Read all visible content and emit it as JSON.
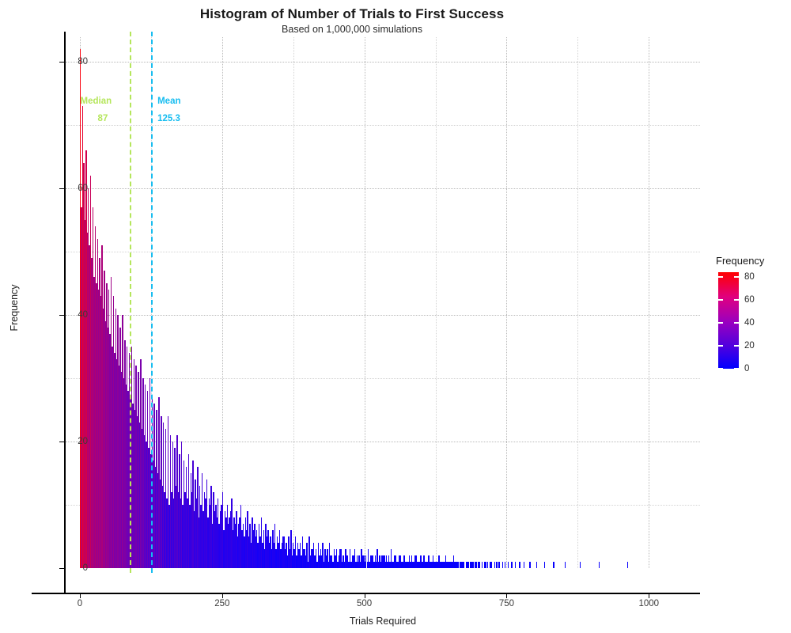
{
  "chart_data": {
    "type": "bar",
    "title": "Histogram of Number of Trials to First Success",
    "subtitle": "Based on 1,000,000 simulations",
    "xlabel": "Trials Required",
    "ylabel": "Frequency",
    "xlim": [
      -25,
      1090
    ],
    "ylim": [
      0,
      84
    ],
    "grid": true,
    "x_ticks": [
      "0",
      "250",
      "500",
      "750",
      "1000"
    ],
    "x_tick_values": [
      0,
      250,
      500,
      750,
      1000
    ],
    "y_ticks": [
      "0",
      "20",
      "40",
      "60",
      "80"
    ],
    "y_tick_values": [
      0,
      20,
      40,
      60,
      80
    ],
    "y_minor_values": [
      10,
      30,
      50,
      70
    ],
    "x_minor_values": [
      125,
      375,
      625,
      875
    ],
    "legend": {
      "title": "Frequency",
      "position": "right",
      "type": "colorbar",
      "ticks": [
        "0",
        "20",
        "40",
        "60",
        "80"
      ],
      "tick_values": [
        0,
        20,
        40,
        60,
        80
      ],
      "low_color": "#0000ff",
      "high_color": "#ff0000",
      "range": [
        0,
        84
      ]
    },
    "annotations": [
      {
        "name": "median",
        "label": "Median",
        "value": "87",
        "x": 87,
        "color": "#b5e65c",
        "linetype": "dashed"
      },
      {
        "name": "mean",
        "label": "Mean",
        "value": "125.3",
        "x": 125.3,
        "color": "#17bdf0",
        "linetype": "dashed"
      }
    ],
    "bin_width": 2,
    "x": [
      1,
      3,
      5,
      7,
      9,
      11,
      13,
      15,
      17,
      19,
      21,
      23,
      25,
      27,
      29,
      31,
      33,
      35,
      37,
      39,
      41,
      43,
      45,
      47,
      49,
      51,
      53,
      55,
      57,
      59,
      61,
      63,
      65,
      67,
      69,
      71,
      73,
      75,
      77,
      79,
      81,
      83,
      85,
      87,
      89,
      91,
      93,
      95,
      97,
      99,
      101,
      103,
      105,
      107,
      109,
      111,
      113,
      115,
      117,
      119,
      121,
      123,
      125,
      127,
      129,
      131,
      133,
      135,
      137,
      139,
      141,
      143,
      145,
      147,
      149,
      151,
      153,
      155,
      157,
      159,
      161,
      163,
      165,
      167,
      169,
      171,
      173,
      175,
      177,
      179,
      181,
      183,
      185,
      187,
      189,
      191,
      193,
      195,
      197,
      199,
      201,
      203,
      205,
      207,
      209,
      211,
      213,
      215,
      217,
      219,
      221,
      223,
      225,
      227,
      229,
      231,
      233,
      235,
      237,
      239,
      241,
      243,
      245,
      247,
      249,
      251,
      253,
      255,
      257,
      259,
      261,
      263,
      265,
      267,
      269,
      271,
      273,
      275,
      277,
      279,
      281,
      283,
      285,
      287,
      289,
      291,
      293,
      295,
      297,
      299,
      301,
      303,
      305,
      307,
      309,
      311,
      313,
      315,
      317,
      319,
      321,
      323,
      325,
      327,
      329,
      331,
      333,
      335,
      337,
      339,
      341,
      343,
      345,
      347,
      349,
      351,
      353,
      355,
      357,
      359,
      361,
      363,
      365,
      367,
      369,
      371,
      373,
      375,
      377,
      379,
      381,
      383,
      385,
      387,
      389,
      391,
      393,
      395,
      397,
      399,
      401,
      403,
      405,
      407,
      409,
      411,
      413,
      415,
      417,
      419,
      421,
      423,
      425,
      427,
      429,
      431,
      433,
      435,
      437,
      439,
      441,
      443,
      445,
      447,
      449,
      451,
      453,
      455,
      457,
      459,
      461,
      463,
      465,
      467,
      469,
      471,
      473,
      475,
      477,
      479,
      481,
      483,
      485,
      487,
      489,
      491,
      493,
      495,
      497,
      499,
      501,
      503,
      505,
      507,
      509,
      511,
      513,
      515,
      517,
      519,
      521,
      523,
      525,
      527,
      529,
      531,
      533,
      535,
      537,
      539,
      541,
      543,
      545,
      547,
      549,
      551,
      553,
      555,
      557,
      559,
      561,
      563,
      565,
      567,
      569,
      571,
      573,
      575,
      577,
      579,
      581,
      583,
      585,
      587,
      589,
      591,
      593,
      595,
      597,
      599,
      601,
      603,
      605,
      607,
      609,
      611,
      613,
      615,
      617,
      619,
      621,
      623,
      625,
      627,
      629,
      631,
      633,
      635,
      637,
      639,
      641,
      643,
      645,
      647,
      649,
      651,
      653,
      655,
      657,
      659,
      661,
      663,
      665,
      667,
      669,
      671,
      673,
      675,
      677,
      679,
      681,
      683,
      685,
      687,
      689,
      691,
      693,
      695,
      697,
      699,
      701,
      703,
      705,
      707,
      709,
      711,
      713,
      715,
      717,
      719,
      721,
      723,
      725,
      727,
      729,
      731,
      733,
      735,
      737,
      739,
      741,
      743,
      745,
      747,
      749,
      751,
      753,
      755,
      757,
      759,
      761,
      763,
      765,
      767,
      769,
      771,
      773,
      775,
      777,
      779,
      781,
      783,
      785,
      787,
      789,
      791,
      793,
      795,
      797,
      799,
      801,
      803,
      805,
      807,
      809,
      811,
      813,
      815,
      817,
      819,
      821,
      823,
      825,
      827,
      829,
      831,
      833,
      835,
      837,
      839,
      841,
      843,
      845,
      847,
      849,
      851,
      853,
      855,
      857,
      859,
      861,
      863,
      865,
      867,
      869,
      871,
      873,
      875,
      877,
      879,
      881,
      883,
      885,
      887,
      889,
      891,
      893,
      895,
      897,
      899,
      901,
      903,
      905,
      907,
      909,
      911,
      913,
      915,
      917,
      919,
      921,
      923,
      925,
      927,
      929,
      931,
      933,
      935,
      937,
      939,
      941,
      943,
      945,
      947,
      949,
      951,
      953,
      955,
      957,
      959,
      961,
      963,
      965,
      967,
      969,
      971,
      973,
      975,
      977,
      979,
      981,
      983,
      985,
      987,
      989,
      991,
      993,
      995,
      997,
      999,
      1001,
      1003,
      1005,
      1007,
      1009,
      1011,
      1013,
      1015,
      1017,
      1019,
      1021,
      1023,
      1025,
      1027,
      1029,
      1031,
      1033,
      1035,
      1037,
      1039,
      1041,
      1043,
      1045,
      1047,
      1049
    ],
    "values": [
      82,
      57,
      73,
      64,
      55,
      66,
      53,
      60,
      51,
      62,
      49,
      57,
      46,
      54,
      45,
      52,
      44,
      49,
      43,
      51,
      41,
      47,
      39,
      45,
      38,
      44,
      37,
      46,
      35,
      43,
      34,
      41,
      33,
      40,
      32,
      38,
      31,
      40,
      30,
      36,
      29,
      35,
      28,
      34,
      27,
      35,
      26,
      33,
      25,
      32,
      24,
      31,
      23,
      33,
      22,
      30,
      21,
      29,
      20,
      28,
      19,
      30,
      18,
      27,
      17,
      26,
      16,
      25,
      15,
      27,
      14,
      24,
      13,
      23,
      12,
      22,
      11,
      24,
      10,
      21,
      12,
      20,
      11,
      19,
      13,
      21,
      12,
      18,
      11,
      20,
      10,
      17,
      12,
      16,
      11,
      18,
      10,
      15,
      12,
      17,
      9,
      14,
      11,
      16,
      8,
      13,
      10,
      15,
      9,
      12,
      11,
      14,
      8,
      11,
      10,
      13,
      7,
      12,
      9,
      10,
      8,
      11,
      7,
      9,
      10,
      12,
      6,
      9,
      8,
      10,
      7,
      8,
      9,
      11,
      6,
      8,
      7,
      9,
      5,
      7,
      8,
      10,
      6,
      7,
      5,
      8,
      6,
      9,
      5,
      7,
      4,
      8,
      6,
      7,
      5,
      6,
      4,
      7,
      5,
      8,
      4,
      6,
      3,
      7,
      5,
      6,
      4,
      5,
      3,
      6,
      4,
      7,
      3,
      5,
      4,
      6,
      3,
      4,
      5,
      5,
      3,
      4,
      2,
      5,
      3,
      6,
      2,
      4,
      3,
      5,
      2,
      4,
      3,
      4,
      2,
      5,
      3,
      3,
      2,
      4,
      1,
      5,
      2,
      3,
      3,
      4,
      2,
      3,
      1,
      4,
      2,
      3,
      2,
      4,
      1,
      3,
      2,
      3,
      1,
      4,
      2,
      2,
      1,
      3,
      2,
      3,
      1,
      2,
      3,
      3,
      1,
      2,
      1,
      3,
      2,
      2,
      1,
      3,
      1,
      2,
      2,
      3,
      1,
      2,
      1,
      2,
      1,
      3,
      2,
      2,
      1,
      2,
      1,
      3,
      1,
      2,
      2,
      2,
      1,
      2,
      1,
      3,
      1,
      2,
      1,
      2,
      2,
      2,
      1,
      2,
      1,
      2,
      1,
      3,
      1,
      1,
      2,
      2,
      1,
      1,
      2,
      2,
      1,
      1,
      2,
      2,
      1,
      1,
      1,
      2,
      1,
      2,
      1,
      1,
      2,
      2,
      1,
      1,
      1,
      2,
      1,
      1,
      2,
      1,
      1,
      1,
      2,
      1,
      1,
      1,
      2,
      1,
      1,
      1,
      1,
      2,
      1,
      1,
      1,
      1,
      1,
      2,
      1,
      1,
      1,
      1,
      1,
      1,
      2,
      1,
      1,
      1,
      1,
      0,
      1,
      1,
      1,
      1,
      0,
      1,
      1,
      1,
      0,
      1,
      1,
      1,
      0,
      1,
      1,
      0,
      1,
      1,
      0,
      1,
      0,
      1,
      1,
      0,
      1,
      0,
      1,
      1,
      0,
      0,
      1,
      0,
      1,
      0,
      1,
      0,
      0,
      1,
      0,
      1,
      0,
      0,
      1,
      0,
      0,
      1,
      0,
      0,
      1,
      0,
      0,
      0,
      1,
      0,
      0,
      0,
      1,
      0,
      0,
      0,
      0,
      1,
      0,
      0,
      0,
      0,
      0,
      1,
      0,
      0,
      0,
      0,
      0,
      0,
      1,
      0,
      0,
      0,
      0,
      0,
      0,
      0,
      1,
      0,
      0,
      0,
      0,
      0,
      0,
      0,
      0,
      0,
      1,
      0,
      0,
      0,
      0,
      0,
      0,
      0,
      0,
      0,
      0,
      0,
      0,
      1,
      0,
      0,
      0,
      0,
      0,
      0,
      0,
      0,
      0,
      0,
      0,
      0,
      0,
      0,
      0,
      0,
      1,
      0,
      0,
      0,
      0,
      0,
      0,
      0,
      0,
      0,
      0,
      0,
      0,
      0,
      0,
      0,
      0,
      0,
      0,
      0,
      0,
      0,
      0,
      0,
      0,
      1
    ]
  }
}
